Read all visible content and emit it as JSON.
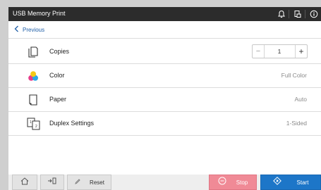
{
  "window": {
    "title": "USB Memory Print"
  },
  "nav": {
    "previous_label": "Previous"
  },
  "settings": [
    {
      "label": "Copies",
      "icon": "copies-icon"
    },
    {
      "label": "Color",
      "value": "Full Color",
      "icon": "color-icon"
    },
    {
      "label": "Paper",
      "value": "Auto",
      "icon": "paper-icon"
    },
    {
      "label": "Duplex Settings",
      "value": "1-Sided",
      "icon": "duplex-icon"
    }
  ],
  "copies": {
    "minus": "−",
    "value": "1",
    "plus": "+"
  },
  "toolbar": {
    "reset_label": "Reset",
    "stop_label": "Stop",
    "start_label": "Start"
  },
  "colors": {
    "titlebar": "#2c2c2c",
    "accent": "#1f5fa8",
    "stop": "#f08a96",
    "start": "#1d76c8"
  }
}
